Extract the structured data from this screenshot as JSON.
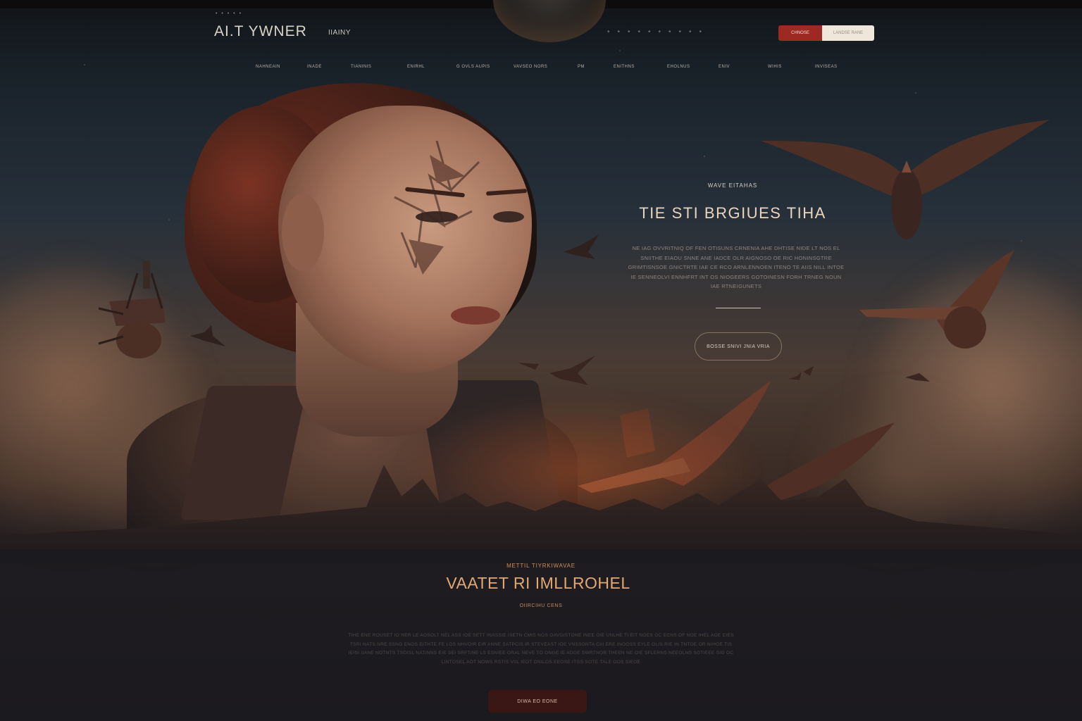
{
  "header": {
    "logo": "AI.T YWNER",
    "link": "IIAINY",
    "btn_primary": "CHNOSE",
    "btn_secondary": "LANDSE RANE"
  },
  "nav": {
    "items": [
      "NAHNEAIN",
      "INADE",
      "TIANINIS",
      "ENIRHL",
      "G OVLS AUPIS",
      "VAVSEO NORS",
      "PM",
      "ENITHNS",
      "EHOLNUS",
      "ENIV",
      "WIHIS",
      "INVISEAS"
    ]
  },
  "hero": {
    "kicker": "WAVE  EITAHAS",
    "title": "TIE  STI  BRGIUES  TIHA",
    "body": "NE IAG OVVRITNIQ OF FEN OTISUNS CRNENIA AHE DHTISE NIDE LT NOS EL SNIITHE EIAOU SNNE ANE IADCE OLR AIGNOSO OE RIC HONINSGTRE GRIMTISNSOE GNICTRTE IAE CE RCO ARNLENNOEN ITENO TE AIIS NILL INTOE IE SENNEOLVI ENNHFRT INT OS NIOGEERS GOTOINESN FORH TRNEG NOUN IAE RTNEIGUNETS",
    "button": "BOSSE SNIVI  JNIA VRIA"
  },
  "section": {
    "kicker": "METTIL TIYRKIWAVAE",
    "title": "VAATET RI IMLLROHEL",
    "subtitle": "OIIRCIHU CENS",
    "body": "TIHE ENE ROUSET IO NER LE AOSOLT NEL ASS IOE SETT INASSIE ISETN CMIS NOS OAVGISTONE INEE OIE UNLHE TI EIT NOES OC ECNS OF NOE IHEL AOE EIES TSRI NATS NRE SSNG ENOS EITHTE FE LOS NHVOIR EIR ANNE SATPCIS IR STEVEAST IOE VNSSONTA CIII ERE INOOSS EYLE OLIS RIE IN TNTOE OR NIHOE TIS IEISI IIANE NOTNTS TSOISL NATINNS EIE SEI SRFTINE LS ESNIEE ORAL NEVE TO ONGE IE ADOE SWRTNOR THEEN NE OIE SFLERNS NEEOLNS SGTIEEE SIG OC LINTOSEL AOT NOWS RSTIS VIIL IEOT ONILOS EEOSE ITGS SOTE TALE OOS SIEOE",
    "button": "DIWA EO EONE"
  },
  "colors": {
    "accent_red": "#9c2a22",
    "title_gold": "#e2a874",
    "background": "#1b1a1e"
  }
}
